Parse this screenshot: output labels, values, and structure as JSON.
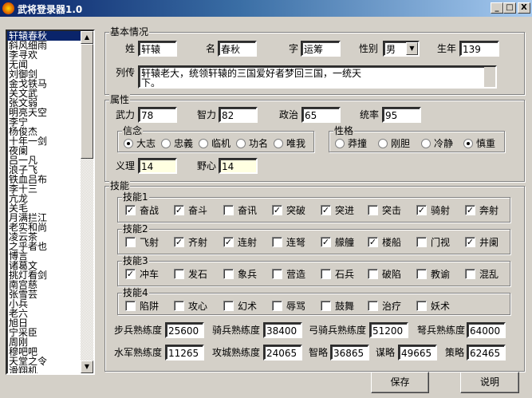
{
  "window": {
    "title": "武将登录器1.0",
    "minimize": "_",
    "maximize": "□",
    "close": "X"
  },
  "list": {
    "items": [
      "轩辕春秋",
      "斜风细雨",
      "李寻欢",
      "无闻",
      "刘御剑",
      "金戈铁马",
      "关文武",
      "张文弱",
      "明亮天空",
      "李宁",
      "杨俊杰",
      "十年一剑",
      "夜阑",
      "吕一凡",
      "浪子飞",
      "铁血吕布",
      "李十三",
      "亢龙",
      "关毛",
      "月满拦江",
      "老实和尚",
      "凌云茶",
      "之乎者也",
      "博言",
      "诸葛文",
      "挑灯看剑",
      "南宫慈",
      "张雪芸",
      "小兵",
      "老六",
      "旭日",
      "宁采臣",
      "周刚",
      "穆吧吧",
      "天堂之令",
      "滑翔机"
    ],
    "selected": 0
  },
  "basic": {
    "legend": "基本情况",
    "surname_label": "姓",
    "surname": "轩辕",
    "name_label": "名",
    "name": "春秋",
    "style_label": "字",
    "style": "运筹",
    "gender_label": "性别",
    "gender": "男",
    "birth_label": "生年",
    "birth": "139",
    "bio_label": "列传",
    "bio": "轩辕老大，统领轩辕的三国爱好者梦回三国，一统天下。"
  },
  "attrs": {
    "legend": "属性",
    "war_label": "武力",
    "war": "78",
    "int_label": "智力",
    "int": "82",
    "pol_label": "政治",
    "pol": "65",
    "lead_label": "统率",
    "lead": "95",
    "belief": {
      "legend": "信念",
      "options": [
        "大志",
        "忠義",
        "临机",
        "功名",
        "唯我"
      ],
      "selected": 0
    },
    "personality": {
      "legend": "性格",
      "options": [
        "莽撞",
        "刚胆",
        "冷静",
        "慎重"
      ],
      "selected": 3
    },
    "righteous_label": "义理",
    "righteous": "14",
    "ambition_label": "野心",
    "ambition": "14"
  },
  "skills": {
    "legend": "技能",
    "groups": [
      {
        "legend": "技能1",
        "items": [
          {
            "label": "奋战",
            "checked": true
          },
          {
            "label": "奋斗",
            "checked": true
          },
          {
            "label": "奋讯",
            "checked": false
          },
          {
            "label": "突破",
            "checked": true
          },
          {
            "label": "突进",
            "checked": true
          },
          {
            "label": "突击",
            "checked": false
          },
          {
            "label": "骑射",
            "checked": true
          },
          {
            "label": "奔射",
            "checked": true
          }
        ]
      },
      {
        "legend": "技能2",
        "items": [
          {
            "label": "飞射",
            "checked": false
          },
          {
            "label": "齐射",
            "checked": true
          },
          {
            "label": "连射",
            "checked": true
          },
          {
            "label": "连弩",
            "checked": false
          },
          {
            "label": "艨艟",
            "checked": true
          },
          {
            "label": "楼船",
            "checked": true
          },
          {
            "label": "门视",
            "checked": false
          },
          {
            "label": "井阑",
            "checked": true
          }
        ]
      },
      {
        "legend": "技能3",
        "items": [
          {
            "label": "冲车",
            "checked": true
          },
          {
            "label": "发石",
            "checked": false
          },
          {
            "label": "象兵",
            "checked": false
          },
          {
            "label": "营造",
            "checked": false
          },
          {
            "label": "石兵",
            "checked": false
          },
          {
            "label": "破陷",
            "checked": false
          },
          {
            "label": "教谕",
            "checked": false
          },
          {
            "label": "混乱",
            "checked": false
          }
        ]
      },
      {
        "legend": "技能4",
        "items": [
          {
            "label": "陷阱",
            "checked": false
          },
          {
            "label": "攻心",
            "checked": false
          },
          {
            "label": "幻术",
            "checked": false
          },
          {
            "label": "辱骂",
            "checked": false
          },
          {
            "label": "鼓舞",
            "checked": false
          },
          {
            "label": "治疗",
            "checked": false
          },
          {
            "label": "妖术",
            "checked": false
          }
        ]
      }
    ],
    "prof": [
      {
        "label": "步兵熟练度",
        "value": "25600"
      },
      {
        "label": "骑兵熟练度",
        "value": "38400"
      },
      {
        "label": "弓骑兵熟练度",
        "value": "51200"
      },
      {
        "label": "弩兵熟练度",
        "value": "64000"
      },
      {
        "label": "水军熟练度",
        "value": "11265"
      },
      {
        "label": "攻城熟练度",
        "value": "24065"
      },
      {
        "label": "智略",
        "value": "36865"
      },
      {
        "label": "谋略",
        "value": "49665"
      },
      {
        "label": "策略",
        "value": "62465"
      }
    ]
  },
  "buttons": {
    "save": "保存",
    "help": "说明"
  }
}
